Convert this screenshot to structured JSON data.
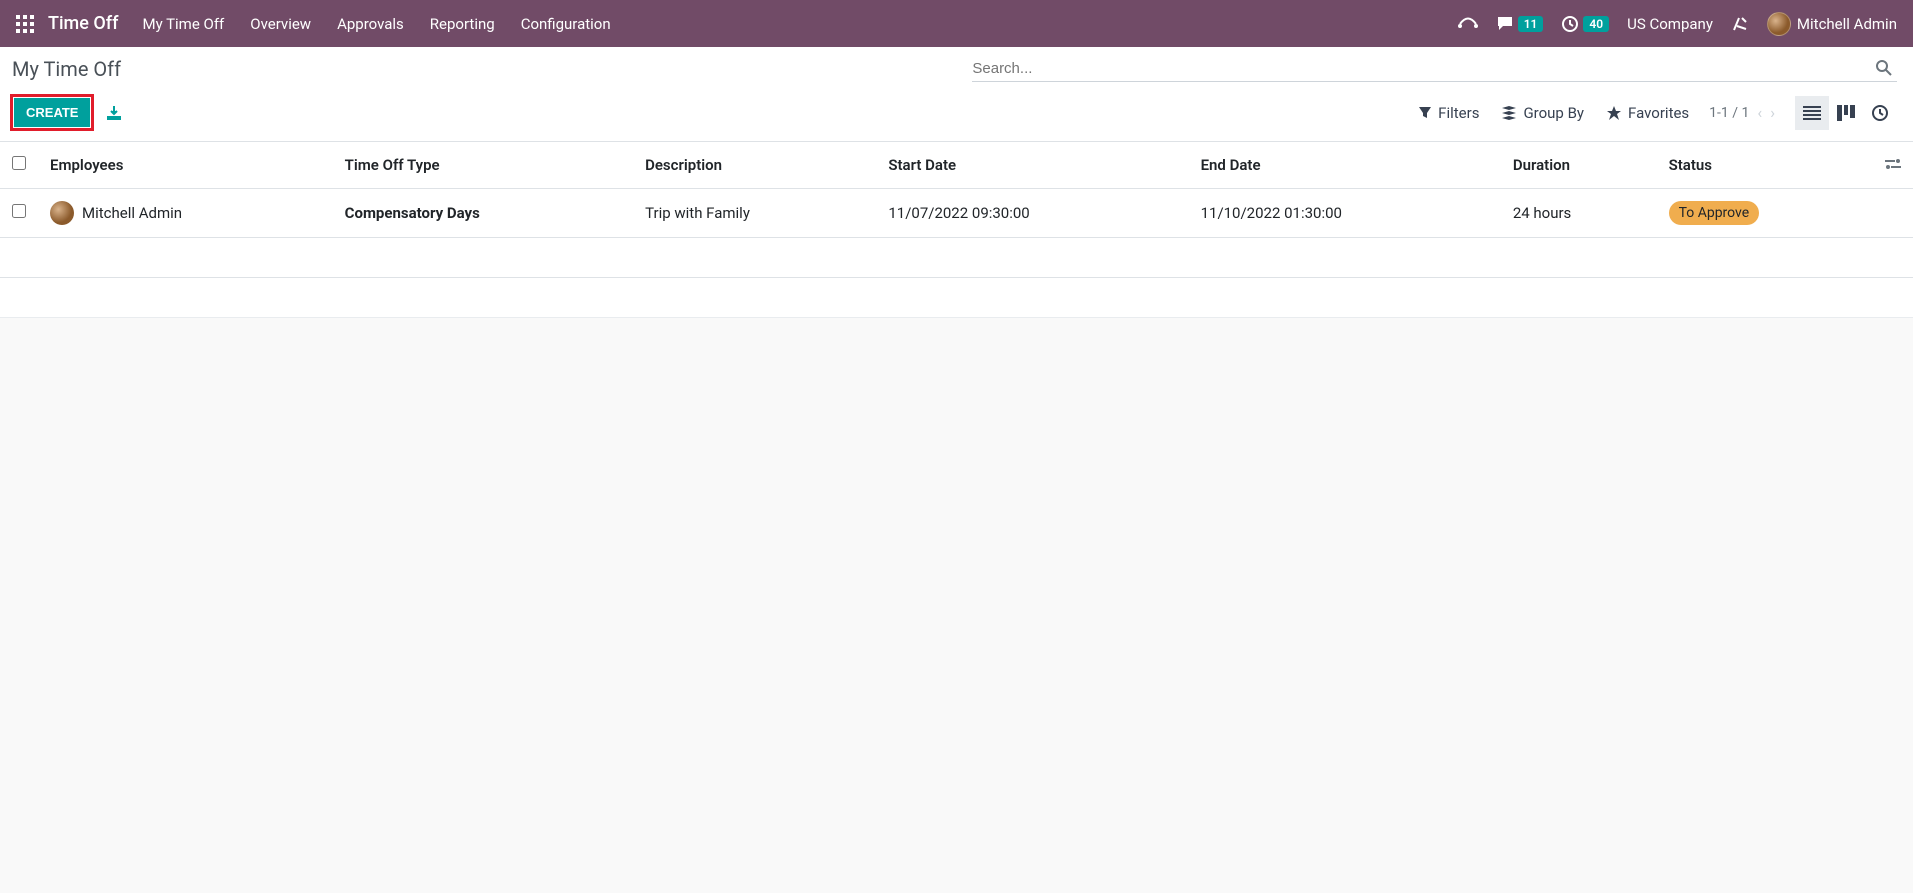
{
  "navbar": {
    "brand": "Time Off",
    "links": [
      "My Time Off",
      "Overview",
      "Approvals",
      "Reporting",
      "Configuration"
    ],
    "messages_badge": "11",
    "activities_badge": "40",
    "company": "US Company",
    "user_name": "Mitchell Admin"
  },
  "control_panel": {
    "title": "My Time Off",
    "search_placeholder": "Search...",
    "create_label": "Create",
    "filters_label": "Filters",
    "groupby_label": "Group By",
    "favorites_label": "Favorites",
    "pager": "1-1 / 1"
  },
  "table": {
    "headers": {
      "employees": "Employees",
      "type": "Time Off Type",
      "description": "Description",
      "start_date": "Start Date",
      "end_date": "End Date",
      "duration": "Duration",
      "status": "Status"
    },
    "rows": [
      {
        "employee": "Mitchell Admin",
        "type": "Compensatory Days",
        "description": "Trip with Family",
        "start_date": "11/07/2022 09:30:00",
        "end_date": "11/10/2022 01:30:00",
        "duration": "24 hours",
        "status": "To Approve"
      }
    ]
  }
}
